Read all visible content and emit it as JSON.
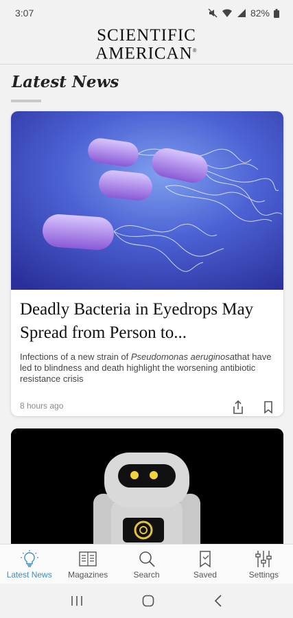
{
  "status_bar": {
    "time": "3:07",
    "battery": "82%"
  },
  "header": {
    "logo_line1": "SCIENTIFIC",
    "logo_line2": "AMERICAN",
    "logo_mark": "®"
  },
  "section": {
    "title": "Latest News"
  },
  "articles": [
    {
      "image": "bacteria-illustration",
      "title": "Deadly Bacteria in Eyedrops May Spread from Person to...",
      "summary_before": "Infections of a new strain of ",
      "summary_italic": "Pseudomonas aeruginosa",
      "summary_after": "that have led to blindness and death highlight the worsening antibiotic resistance crisis",
      "time": "8 hours ago",
      "share_icon": "share-icon",
      "save_icon": "bookmark-icon"
    },
    {
      "image": "robot-illustration"
    }
  ],
  "bottom_nav": {
    "items": [
      {
        "label": "Latest News",
        "icon": "lightbulb-icon",
        "active": true
      },
      {
        "label": "Magazines",
        "icon": "magazine-icon",
        "active": false
      },
      {
        "label": "Search",
        "icon": "search-icon",
        "active": false
      },
      {
        "label": "Saved",
        "icon": "bookmark-icon",
        "active": false
      },
      {
        "label": "Settings",
        "icon": "sliders-icon",
        "active": false
      }
    ]
  },
  "colors": {
    "accent": "#3a8fc6",
    "background": "#f2f2f2",
    "card": "#ffffff"
  }
}
